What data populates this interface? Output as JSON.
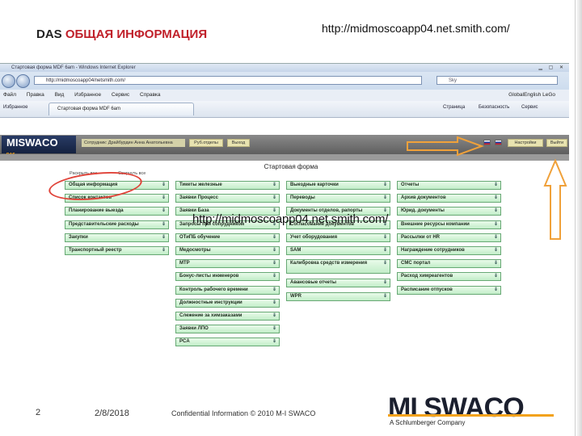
{
  "slide": {
    "title_prefix": "DAS",
    "title_highlight": "ОБЩАЯ ИНФОРМАЦИЯ",
    "url_note": "http://midmoscoapp04.net.smith.com/",
    "overlay_url": "http://midmoscoapp04.net.smith.com/",
    "page_number": "2",
    "date": "2/8/2018",
    "confidential": "Confidential Information © 2010 M-I SWACO",
    "logo": "MI SWACO",
    "logo_sub": "A Schlumberger Company"
  },
  "browser": {
    "window_title": "Стартовая форма MDF 6am - Windows Internet Explorer",
    "address": "http://midmoscoapp04/netsmith.com/",
    "search_placeholder": "Sky",
    "menu": [
      "Файл",
      "Правка",
      "Вид",
      "Избранное",
      "Сервис",
      "Справка"
    ],
    "favorites_label": "Избранное",
    "tab_label": "Стартовая форма MDF 6am",
    "cmd_right": [
      "Страница",
      "Безопасность",
      "Сервис"
    ],
    "global_english": "GlobalEnglish LeGo"
  },
  "app": {
    "logo": "MISWACO",
    "logo_sub": "DAS",
    "user_info": "Сотрудник: Драйбурдин Анна Анатольевна",
    "btn_subsidiary": "Руб.отделы",
    "btn_exit": "Выход",
    "btn_settings": "Настройки",
    "btn_help": "Выйти",
    "page_title": "Стартовая форма",
    "col_heads": [
      "Раскрыть все",
      "Свернуть все"
    ]
  },
  "columns": [
    [
      "Общая информация",
      "Список контактов",
      "Планирование выезда",
      "Представительские расходы",
      "Закупки",
      "Транспортный реестр"
    ],
    [
      "Тикеты железные",
      "Заявки Процесс",
      "Заявки База",
      "Запросы при сопрудником",
      "ОТиПБ обучение",
      "Медосмотры",
      "МТР",
      "Бонус-листы инженеров",
      "Контроль рабочего времени",
      "Должностные инструкции",
      "Слежение за химзаказами",
      "Заявки ЛПО",
      "PCA"
    ],
    [
      "Выездные карточки",
      "Переводы",
      "Документы отделов, рапорты",
      "Согласование документов",
      "Учет оборудования",
      "SAM",
      "Калибровка средств измерения",
      "Авансовые отчеты",
      "WPR"
    ],
    [
      "Отчеты",
      "Архив документов",
      "Юрид. документы",
      "Внешние ресурсы компании",
      "Рассылки от HR",
      "Награждение сотрудников",
      "CMC портал",
      "Расход химреагентов",
      "Расписание отпусков"
    ]
  ]
}
